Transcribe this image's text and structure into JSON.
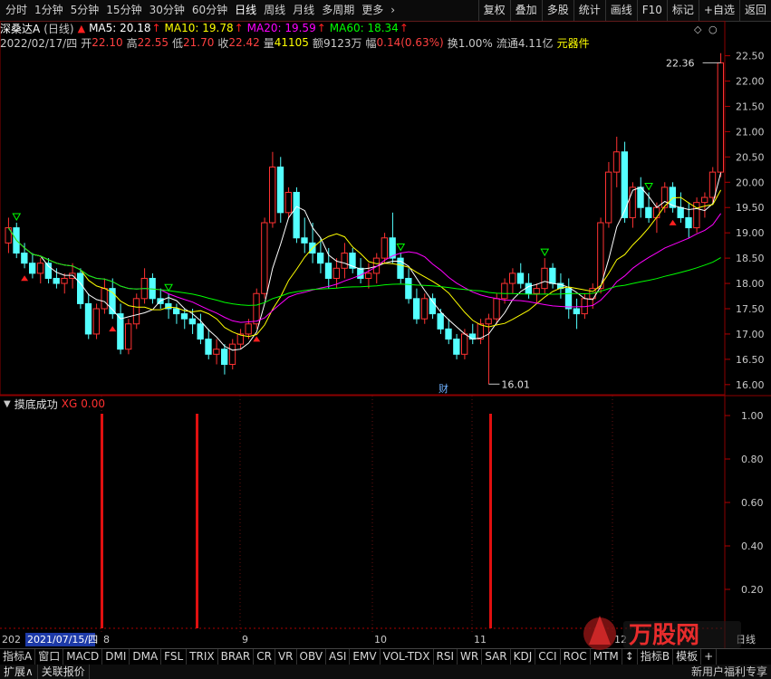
{
  "toolbar": {
    "periods": [
      "分时",
      "1分钟",
      "5分钟",
      "15分钟",
      "30分钟",
      "60分钟",
      "日线",
      "周线",
      "月线",
      "多周期",
      "更多"
    ],
    "active_period": "日线",
    "more_arrow": "›",
    "right_buttons": [
      "复权",
      "叠加",
      "多股",
      "统计",
      "画线",
      "F10",
      "标记",
      "+自选",
      "返回"
    ]
  },
  "stock": {
    "name": "深桑达A",
    "period_label": "(日线)",
    "date": "2022/02/17/四",
    "open_label": "开",
    "open": "22.10",
    "high_label": "高",
    "high": "22.55",
    "low_label": "低",
    "low": "21.70",
    "close_label": "收",
    "close": "22.42",
    "vol_label": "量",
    "volume": "41105",
    "amount_label": "额",
    "amount": "9123万",
    "change_label": "幅",
    "change": "0.14(0.63%)",
    "turnover": "换1.00%",
    "float_cap": "流通4.11亿",
    "sector": "元器件"
  },
  "ma": [
    {
      "label": "MA5: 20.18",
      "color": "#ffffff"
    },
    {
      "label": "MA10: 19.78",
      "color": "#ffff00"
    },
    {
      "label": "MA20: 19.59",
      "color": "#ff00ff"
    },
    {
      "label": "MA60: 18.34",
      "color": "#00ff00"
    }
  ],
  "price_axis": [
    "22.50",
    "22.00",
    "21.50",
    "21.00",
    "20.50",
    "20.00",
    "19.50",
    "19.00",
    "18.50",
    "18.00",
    "17.50",
    "17.00",
    "16.50",
    "16.00"
  ],
  "annotations": {
    "high_label": "22.36",
    "low_label": "16.01",
    "finance_mark": "财"
  },
  "month_labels": [
    "8",
    "9",
    "10",
    "11",
    "12"
  ],
  "sub_indicator": {
    "name": "摸底成功",
    "var_label": "XG",
    "var_value": "0.00",
    "axis": [
      "1.00",
      "0.80",
      "0.60",
      "0.40",
      "0.20"
    ],
    "date_prefix": "202",
    "date_label": "2021/07/15/四",
    "period_tag": "日线",
    "signals": [
      1,
      1,
      1
    ]
  },
  "chart_data": {
    "type": "candlestick",
    "ylim": [
      15.8,
      22.6
    ],
    "candles": [
      [
        18.8,
        19.3,
        18.6,
        19.1
      ],
      [
        19.1,
        19.2,
        18.5,
        18.6
      ],
      [
        18.6,
        18.8,
        18.3,
        18.4
      ],
      [
        18.4,
        18.6,
        18.1,
        18.2
      ],
      [
        18.2,
        18.5,
        18.0,
        18.4
      ],
      [
        18.4,
        18.5,
        18.0,
        18.1
      ],
      [
        18.1,
        18.3,
        17.9,
        18.0
      ],
      [
        18.0,
        18.2,
        17.8,
        18.1
      ],
      [
        18.1,
        18.4,
        17.9,
        18.2
      ],
      [
        18.2,
        18.3,
        17.5,
        17.6
      ],
      [
        17.6,
        17.8,
        16.9,
        17.0
      ],
      [
        17.0,
        17.6,
        16.9,
        17.5
      ],
      [
        17.5,
        18.1,
        17.4,
        17.9
      ],
      [
        17.9,
        18.1,
        17.3,
        17.4
      ],
      [
        17.4,
        17.6,
        16.6,
        16.7
      ],
      [
        16.7,
        17.3,
        16.6,
        17.2
      ],
      [
        17.2,
        17.8,
        17.1,
        17.7
      ],
      [
        17.7,
        18.3,
        17.6,
        18.1
      ],
      [
        18.1,
        18.2,
        17.6,
        17.7
      ],
      [
        17.7,
        17.9,
        17.5,
        17.6
      ],
      [
        17.6,
        17.8,
        17.3,
        17.5
      ],
      [
        17.5,
        17.6,
        17.2,
        17.4
      ],
      [
        17.4,
        17.5,
        17.1,
        17.3
      ],
      [
        17.3,
        17.5,
        17.0,
        17.2
      ],
      [
        17.2,
        17.4,
        16.8,
        16.9
      ],
      [
        16.9,
        17.1,
        16.5,
        16.6
      ],
      [
        16.6,
        16.9,
        16.4,
        16.7
      ],
      [
        16.7,
        16.8,
        16.2,
        16.4
      ],
      [
        16.4,
        16.9,
        16.3,
        16.8
      ],
      [
        16.8,
        17.1,
        16.7,
        17.0
      ],
      [
        17.0,
        17.3,
        16.9,
        17.2
      ],
      [
        17.2,
        17.9,
        17.1,
        17.8
      ],
      [
        17.8,
        19.3,
        17.7,
        19.2
      ],
      [
        19.2,
        20.6,
        19.1,
        20.3
      ],
      [
        20.3,
        20.5,
        19.2,
        19.4
      ],
      [
        19.4,
        19.9,
        19.3,
        19.8
      ],
      [
        19.8,
        19.9,
        18.8,
        18.9
      ],
      [
        18.9,
        19.3,
        18.6,
        18.8
      ],
      [
        18.8,
        19.2,
        18.4,
        18.6
      ],
      [
        18.6,
        18.9,
        18.2,
        18.4
      ],
      [
        18.4,
        18.7,
        17.9,
        18.1
      ],
      [
        18.1,
        18.5,
        17.9,
        18.3
      ],
      [
        18.3,
        18.8,
        18.1,
        18.6
      ],
      [
        18.6,
        18.7,
        18.2,
        18.3
      ],
      [
        18.3,
        18.5,
        18.0,
        18.1
      ],
      [
        18.1,
        18.4,
        17.9,
        18.2
      ],
      [
        18.2,
        18.6,
        18.0,
        18.5
      ],
      [
        18.5,
        19.0,
        18.4,
        18.9
      ],
      [
        18.9,
        19.4,
        18.4,
        18.5
      ],
      [
        18.5,
        18.6,
        18.0,
        18.1
      ],
      [
        18.1,
        18.3,
        17.6,
        17.7
      ],
      [
        17.7,
        17.9,
        17.2,
        17.3
      ],
      [
        17.3,
        17.8,
        17.2,
        17.7
      ],
      [
        17.7,
        17.8,
        17.3,
        17.4
      ],
      [
        17.4,
        17.5,
        17.0,
        17.1
      ],
      [
        17.1,
        17.3,
        16.8,
        16.9
      ],
      [
        16.9,
        17.0,
        16.5,
        16.6
      ],
      [
        16.6,
        17.1,
        16.5,
        17.0
      ],
      [
        17.0,
        17.2,
        16.8,
        16.9
      ],
      [
        16.9,
        17.3,
        16.8,
        17.2
      ],
      [
        17.2,
        17.4,
        16.01,
        17.3
      ],
      [
        17.3,
        17.8,
        17.2,
        17.7
      ],
      [
        17.7,
        18.1,
        17.6,
        18.0
      ],
      [
        18.0,
        18.3,
        17.8,
        18.2
      ],
      [
        18.2,
        18.4,
        17.9,
        18.0
      ],
      [
        18.0,
        18.2,
        17.7,
        17.8
      ],
      [
        17.8,
        18.0,
        17.6,
        17.9
      ],
      [
        17.9,
        18.5,
        17.8,
        18.3
      ],
      [
        18.3,
        18.4,
        17.9,
        18.0
      ],
      [
        18.0,
        18.2,
        17.7,
        17.9
      ],
      [
        17.9,
        18.1,
        17.3,
        17.5
      ],
      [
        17.5,
        17.7,
        17.1,
        17.4
      ],
      [
        17.4,
        17.8,
        17.3,
        17.7
      ],
      [
        17.7,
        18.0,
        17.5,
        17.9
      ],
      [
        17.9,
        19.3,
        17.8,
        19.2
      ],
      [
        19.2,
        20.4,
        19.1,
        20.2
      ],
      [
        20.2,
        20.9,
        19.9,
        20.6
      ],
      [
        20.6,
        20.8,
        19.2,
        19.3
      ],
      [
        19.3,
        20.0,
        19.1,
        19.9
      ],
      [
        19.9,
        20.1,
        19.3,
        19.5
      ],
      [
        19.5,
        19.8,
        19.2,
        19.3
      ],
      [
        19.3,
        19.6,
        19.0,
        19.5
      ],
      [
        19.5,
        20.0,
        19.4,
        19.9
      ],
      [
        19.9,
        20.0,
        19.4,
        19.5
      ],
      [
        19.5,
        19.8,
        19.2,
        19.3
      ],
      [
        19.3,
        19.6,
        18.9,
        19.1
      ],
      [
        19.1,
        19.7,
        19.0,
        19.6
      ],
      [
        19.6,
        19.8,
        19.3,
        19.7
      ],
      [
        19.7,
        20.3,
        19.6,
        20.2
      ],
      [
        20.2,
        22.55,
        20.1,
        22.36
      ]
    ]
  }
}
